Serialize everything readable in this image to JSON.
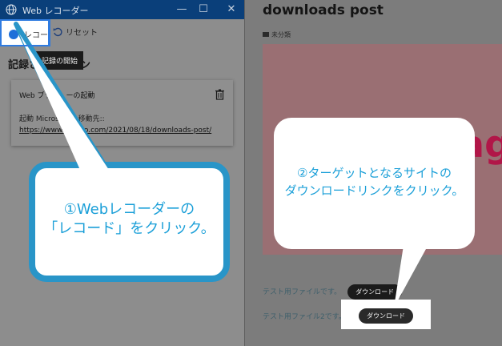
{
  "recorder": {
    "title": "Web レコーダー",
    "record_label": "レコード",
    "reset_label": "リセット",
    "tooltip": "記録の開始",
    "heading_left": "記録さ",
    "heading_right": "ン",
    "card": {
      "title": "Web ブラ",
      "title_tail": "ーの起動",
      "line1": "起動 Microsoft Edge 移動先::",
      "line1_short": "起動 Micros",
      "line1_tail": "dge 移動先::",
      "url": "https://www.",
      "url_tail": "lo.com/2021/08/18/downloads-post/"
    }
  },
  "page": {
    "post_title": "downloads post",
    "category": "未分類",
    "hero_word": "ag",
    "row1_text": "テスト用ファイルです。",
    "row2_text": "テスト用ファイル2です。",
    "download_label": "ダウンロード"
  },
  "callouts": {
    "one_line1": "①Webレコーダーの",
    "one_line2": "「レコード」をクリック。",
    "two_line1": "②ターゲットとなるサイトの",
    "two_line2": "ダウンロードリンクをクリック。"
  },
  "colors": {
    "accent": "#1a9fd8",
    "callout_border": "#2995c8",
    "titlebar": "#0a3f7a"
  }
}
